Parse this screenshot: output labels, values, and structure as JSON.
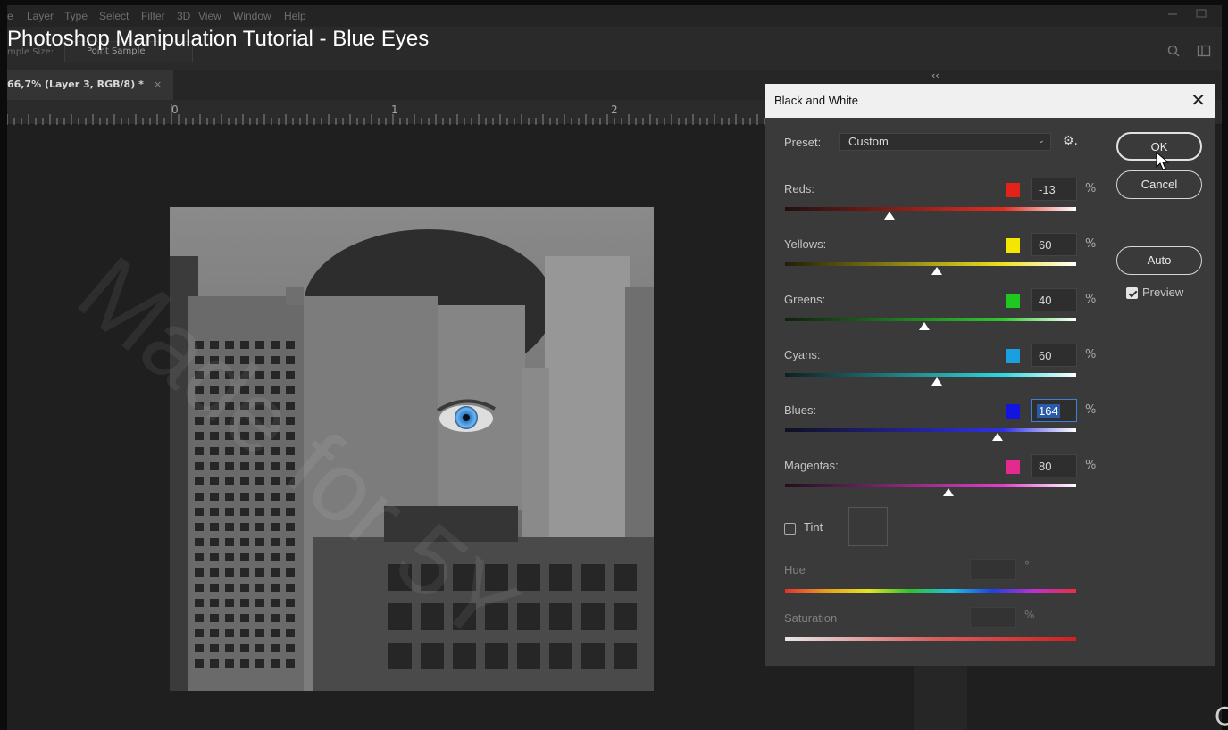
{
  "menubar": {
    "items": [
      "e",
      "Layer",
      "Type",
      "Select",
      "Filter",
      "3D",
      "View",
      "Window",
      "Help"
    ]
  },
  "options": {
    "sample_size_label": "mple Size:",
    "sample_size_value": "Point Sample"
  },
  "video_title": "Photoshop Manipulation Tutorial - Blue Eyes",
  "document_tab": {
    "title": "66,7% (Layer 3, RGB/8) *",
    "close": "×"
  },
  "panel_collapse": "‹‹",
  "ruler": {
    "labels": [
      "0",
      "1",
      "2"
    ]
  },
  "dialog": {
    "title": "Black and White",
    "close": "✕",
    "preset_label": "Preset:",
    "preset_value": "Custom",
    "preset_chevron": "⌄",
    "gear_glyph": "⚙.",
    "buttons": {
      "ok": "OK",
      "cancel": "Cancel",
      "auto": "Auto"
    },
    "preview_label": "Preview",
    "preview_checked": true,
    "percent": "%",
    "sliders": [
      {
        "name": "reds",
        "label": "Reds:",
        "value": "-13",
        "swatch": "#e5221a",
        "gradient": [
          "#201010",
          "#e22d20"
        ],
        "thumb_fraction": 0.36
      },
      {
        "name": "yellows",
        "label": "Yellows:",
        "value": "60",
        "swatch": "#f5e600",
        "gradient": [
          "#201f08",
          "#f0e020"
        ],
        "thumb_fraction": 0.52
      },
      {
        "name": "greens",
        "label": "Greens:",
        "value": "40",
        "swatch": "#1ec81e",
        "gradient": [
          "#102010",
          "#2ec92e"
        ],
        "thumb_fraction": 0.48
      },
      {
        "name": "cyans",
        "label": "Cyans:",
        "value": "60",
        "swatch": "#1a9fe0",
        "gradient": [
          "#0f2020",
          "#2fd8e0"
        ],
        "thumb_fraction": 0.52
      },
      {
        "name": "blues",
        "label": "Blues:",
        "value": "164",
        "swatch": "#1414e0",
        "gradient": [
          "#101020",
          "#3030e5"
        ],
        "thumb_fraction": 0.73,
        "active": true
      },
      {
        "name": "magentas",
        "label": "Magentas:",
        "value": "80",
        "swatch": "#e52a8f",
        "gradient": [
          "#200f1a",
          "#e040c8"
        ],
        "thumb_fraction": 0.56
      }
    ],
    "tint_label": "Tint",
    "tint_checked": false,
    "hue_label": "Hue",
    "hue_unit": "°",
    "saturation_label": "Saturation",
    "saturation_unit": "%"
  },
  "watermark_text": "Made for 5Y",
  "edge_char": "C"
}
